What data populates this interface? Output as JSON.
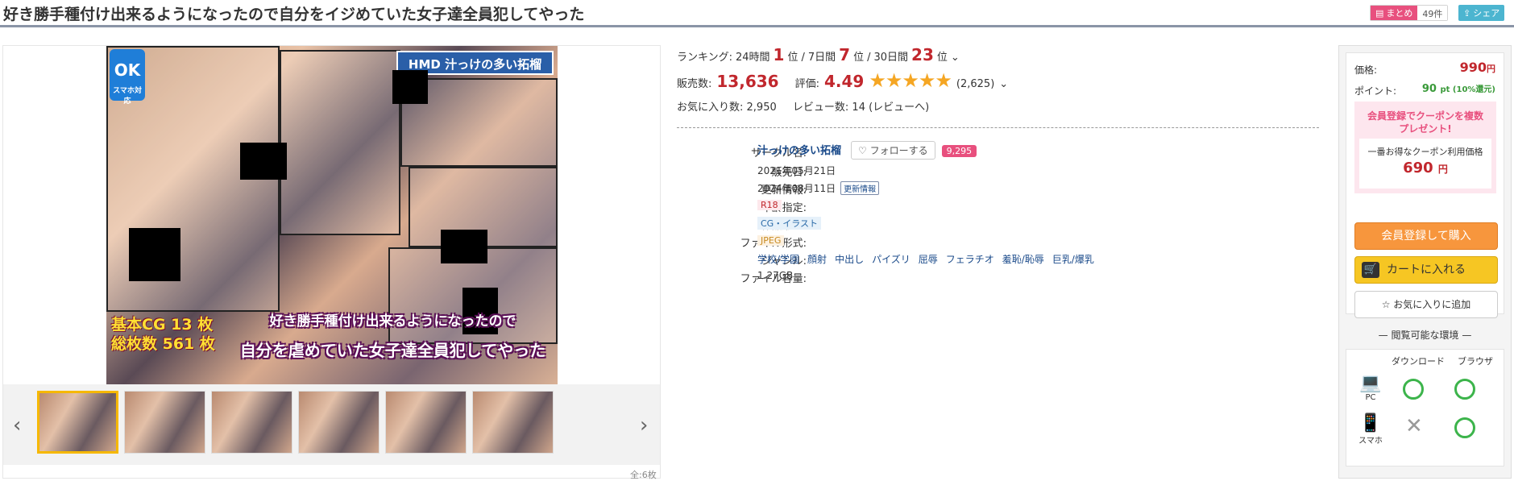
{
  "title": "好き勝手種付け出来るようになったので自分をイジめていた女子達全員犯してやった",
  "actions": {
    "matome_label": "まとめ",
    "matome_count": "49件",
    "share_label": "シェア"
  },
  "gallery": {
    "ok_badge": "OK",
    "ok_badge_sub": "スマホ対応",
    "logo_text": "HMD 汁っけの多い拓榴",
    "cg_line1": "基本CG 13 枚",
    "cg_line2": "総枚数 561 枚",
    "cover_title_line1": "好き勝手種付け出来るようになったので",
    "cover_title_line2": "自分を虐めていた女子達全員犯してやった",
    "total": "全:6枚",
    "thumb_count": 6
  },
  "ranking": {
    "label": "ランキング:",
    "p24_label": "24時間",
    "p24": "1",
    "p7_label": "7日間",
    "p7": "7",
    "p30_label": "30日間",
    "p30": "23",
    "rank_unit": "位"
  },
  "sales": {
    "label": "販売数:",
    "value": "13,636",
    "rating_label": "評価:",
    "rating": "4.49",
    "stars": "★★★★★",
    "rating_count": "(2,625)"
  },
  "stats": {
    "fav_label": "お気に入り数:",
    "fav": "2,950",
    "review_label": "レビュー数:",
    "review": "14",
    "review_link": "(レビューへ)"
  },
  "details": {
    "circle_label": "サークル名:",
    "circle": "汁っけの多い拓榴",
    "follow": "フォローする",
    "followers": "9,295",
    "release_label": "販売日:",
    "release": "2021年05月21日",
    "update_label": "更新情報:",
    "update": "2024年08月11日",
    "update_tag": "更新情報",
    "age_label": "年齢指定:",
    "age": "R18",
    "form_label": "作品形式:",
    "form": "CG・イラスト",
    "file_label": "ファイル形式:",
    "file": "JPEG",
    "genre_label": "ジャンル:",
    "genres": [
      "学校/学園",
      "顔射",
      "中出し",
      "パイズリ",
      "屈辱",
      "フェラチオ",
      "羞恥/恥辱",
      "巨乳/爆乳"
    ],
    "size_label": "ファイル容量:",
    "size": "1.27GB"
  },
  "purchase": {
    "price_label": "価格:",
    "price": "990",
    "yen": "円",
    "point_label": "ポイント:",
    "point": "90",
    "point_suffix": "pt (10%還元)",
    "coupon_title1": "会員登録でクーポンを複数",
    "coupon_title2": "プレゼント!",
    "coupon_sub": "一番お得なクーポン利用価格",
    "coupon_price": "690",
    "register_buy": "会員登録して購入",
    "add_cart": "カートに入れる",
    "add_fav": "お気に入りに追加"
  },
  "env": {
    "title": "閲覧可能な環境",
    "col_download": "ダウンロード",
    "col_browser": "ブラウザ",
    "pc": "PC",
    "phone": "スマホ"
  },
  "colors": {
    "accent_red": "#c1272d",
    "pink": "#e8507e",
    "orange": "#f7963d",
    "yellow": "#f6c623",
    "green": "#3cb44b"
  }
}
